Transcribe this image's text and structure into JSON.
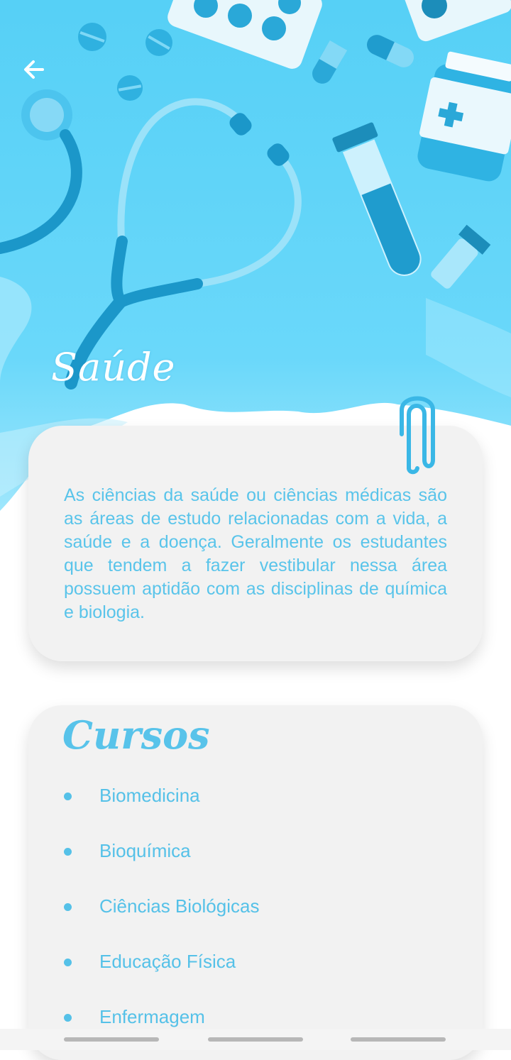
{
  "header": {
    "title": "Saúde",
    "back_icon": "arrow-left-icon"
  },
  "description": {
    "text": "As ciências da saúde ou ciências médicas são as áreas de estudo relacionadas com a vida, a saúde e a doença. Geralmente os estudantes que tendem a fazer vestibular nessa área possuem aptidão com as disciplinas de química e biologia."
  },
  "courses": {
    "title": "Cursos",
    "items": [
      {
        "label": "Biomedicina"
      },
      {
        "label": "Bioquímica"
      },
      {
        "label": "Ciências Biológicas"
      },
      {
        "label": "Educação Física"
      },
      {
        "label": "Enfermagem"
      }
    ]
  },
  "colors": {
    "accent": "#55c1e8",
    "hero_background": "#5fd3f7",
    "card_background": "#f2f2f2"
  }
}
